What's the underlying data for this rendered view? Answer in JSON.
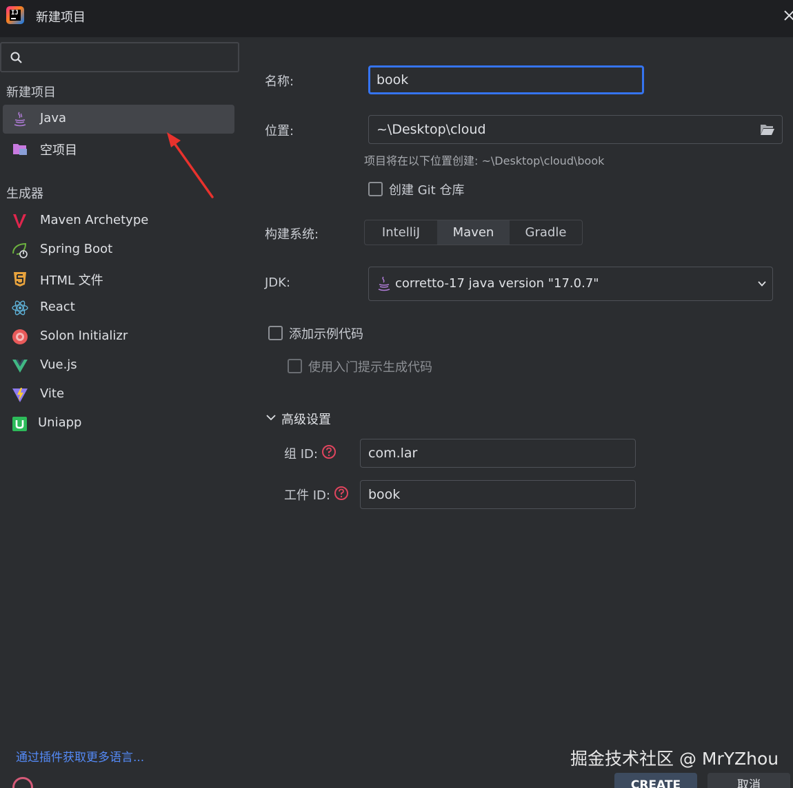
{
  "window": {
    "title": "新建项目"
  },
  "sidebar": {
    "search": {
      "value": "",
      "placeholder": ""
    },
    "section_new_project": "新建项目",
    "new_project_items": [
      {
        "label": "Java",
        "icon": "java-icon",
        "selected": true
      },
      {
        "label": "空项目",
        "icon": "empty-project-icon",
        "selected": false
      }
    ],
    "section_generators": "生成器",
    "generator_items": [
      {
        "label": "Maven Archetype",
        "icon": "maven-icon"
      },
      {
        "label": "Spring Boot",
        "icon": "spring-boot-icon"
      },
      {
        "label": "HTML 文件",
        "icon": "html5-icon"
      },
      {
        "label": "React",
        "icon": "react-icon"
      },
      {
        "label": "Solon Initializr",
        "icon": "solon-icon"
      },
      {
        "label": "Vue.js",
        "icon": "vue-icon"
      },
      {
        "label": "Vite",
        "icon": "vite-icon"
      },
      {
        "label": "Uniapp",
        "icon": "uniapp-icon"
      }
    ],
    "plugin_link": "通过插件获取更多语言..."
  },
  "form": {
    "name_label": "名称:",
    "name_value": "book",
    "location_label": "位置:",
    "location_value": "~\\Desktop\\cloud",
    "location_hint": "项目将在以下位置创建: ~\\Desktop\\cloud\\book",
    "git_checkbox": {
      "label": "创建 Git 仓库",
      "checked": false
    },
    "build_system_label": "构建系统:",
    "build_systems": [
      "IntelliJ",
      "Maven",
      "Gradle"
    ],
    "build_system_selected": "Maven",
    "jdk_label": "JDK:",
    "jdk_value": "corretto-17 java version \"17.0.7\"",
    "sample_code_checkbox": {
      "label": "添加示例代码",
      "checked": false
    },
    "onboarding_checkbox": {
      "label": "使用入门提示生成代码",
      "checked": false,
      "disabled": true
    },
    "advanced_label": "高级设置",
    "group_id_label": "组 ID:",
    "group_id_value": "com.lar",
    "artifact_id_label": "工件 ID:",
    "artifact_id_value": "book"
  },
  "footer": {
    "create_label": "CREATE",
    "cancel_label": "取消"
  },
  "watermark": "掘金技术社区 @ MrYZhou",
  "colors": {
    "background": "#2b2d30",
    "titlebar": "#1e1f22",
    "accent": "#3574f0",
    "link": "#548af7",
    "annotation_arrow": "#e8322d"
  }
}
